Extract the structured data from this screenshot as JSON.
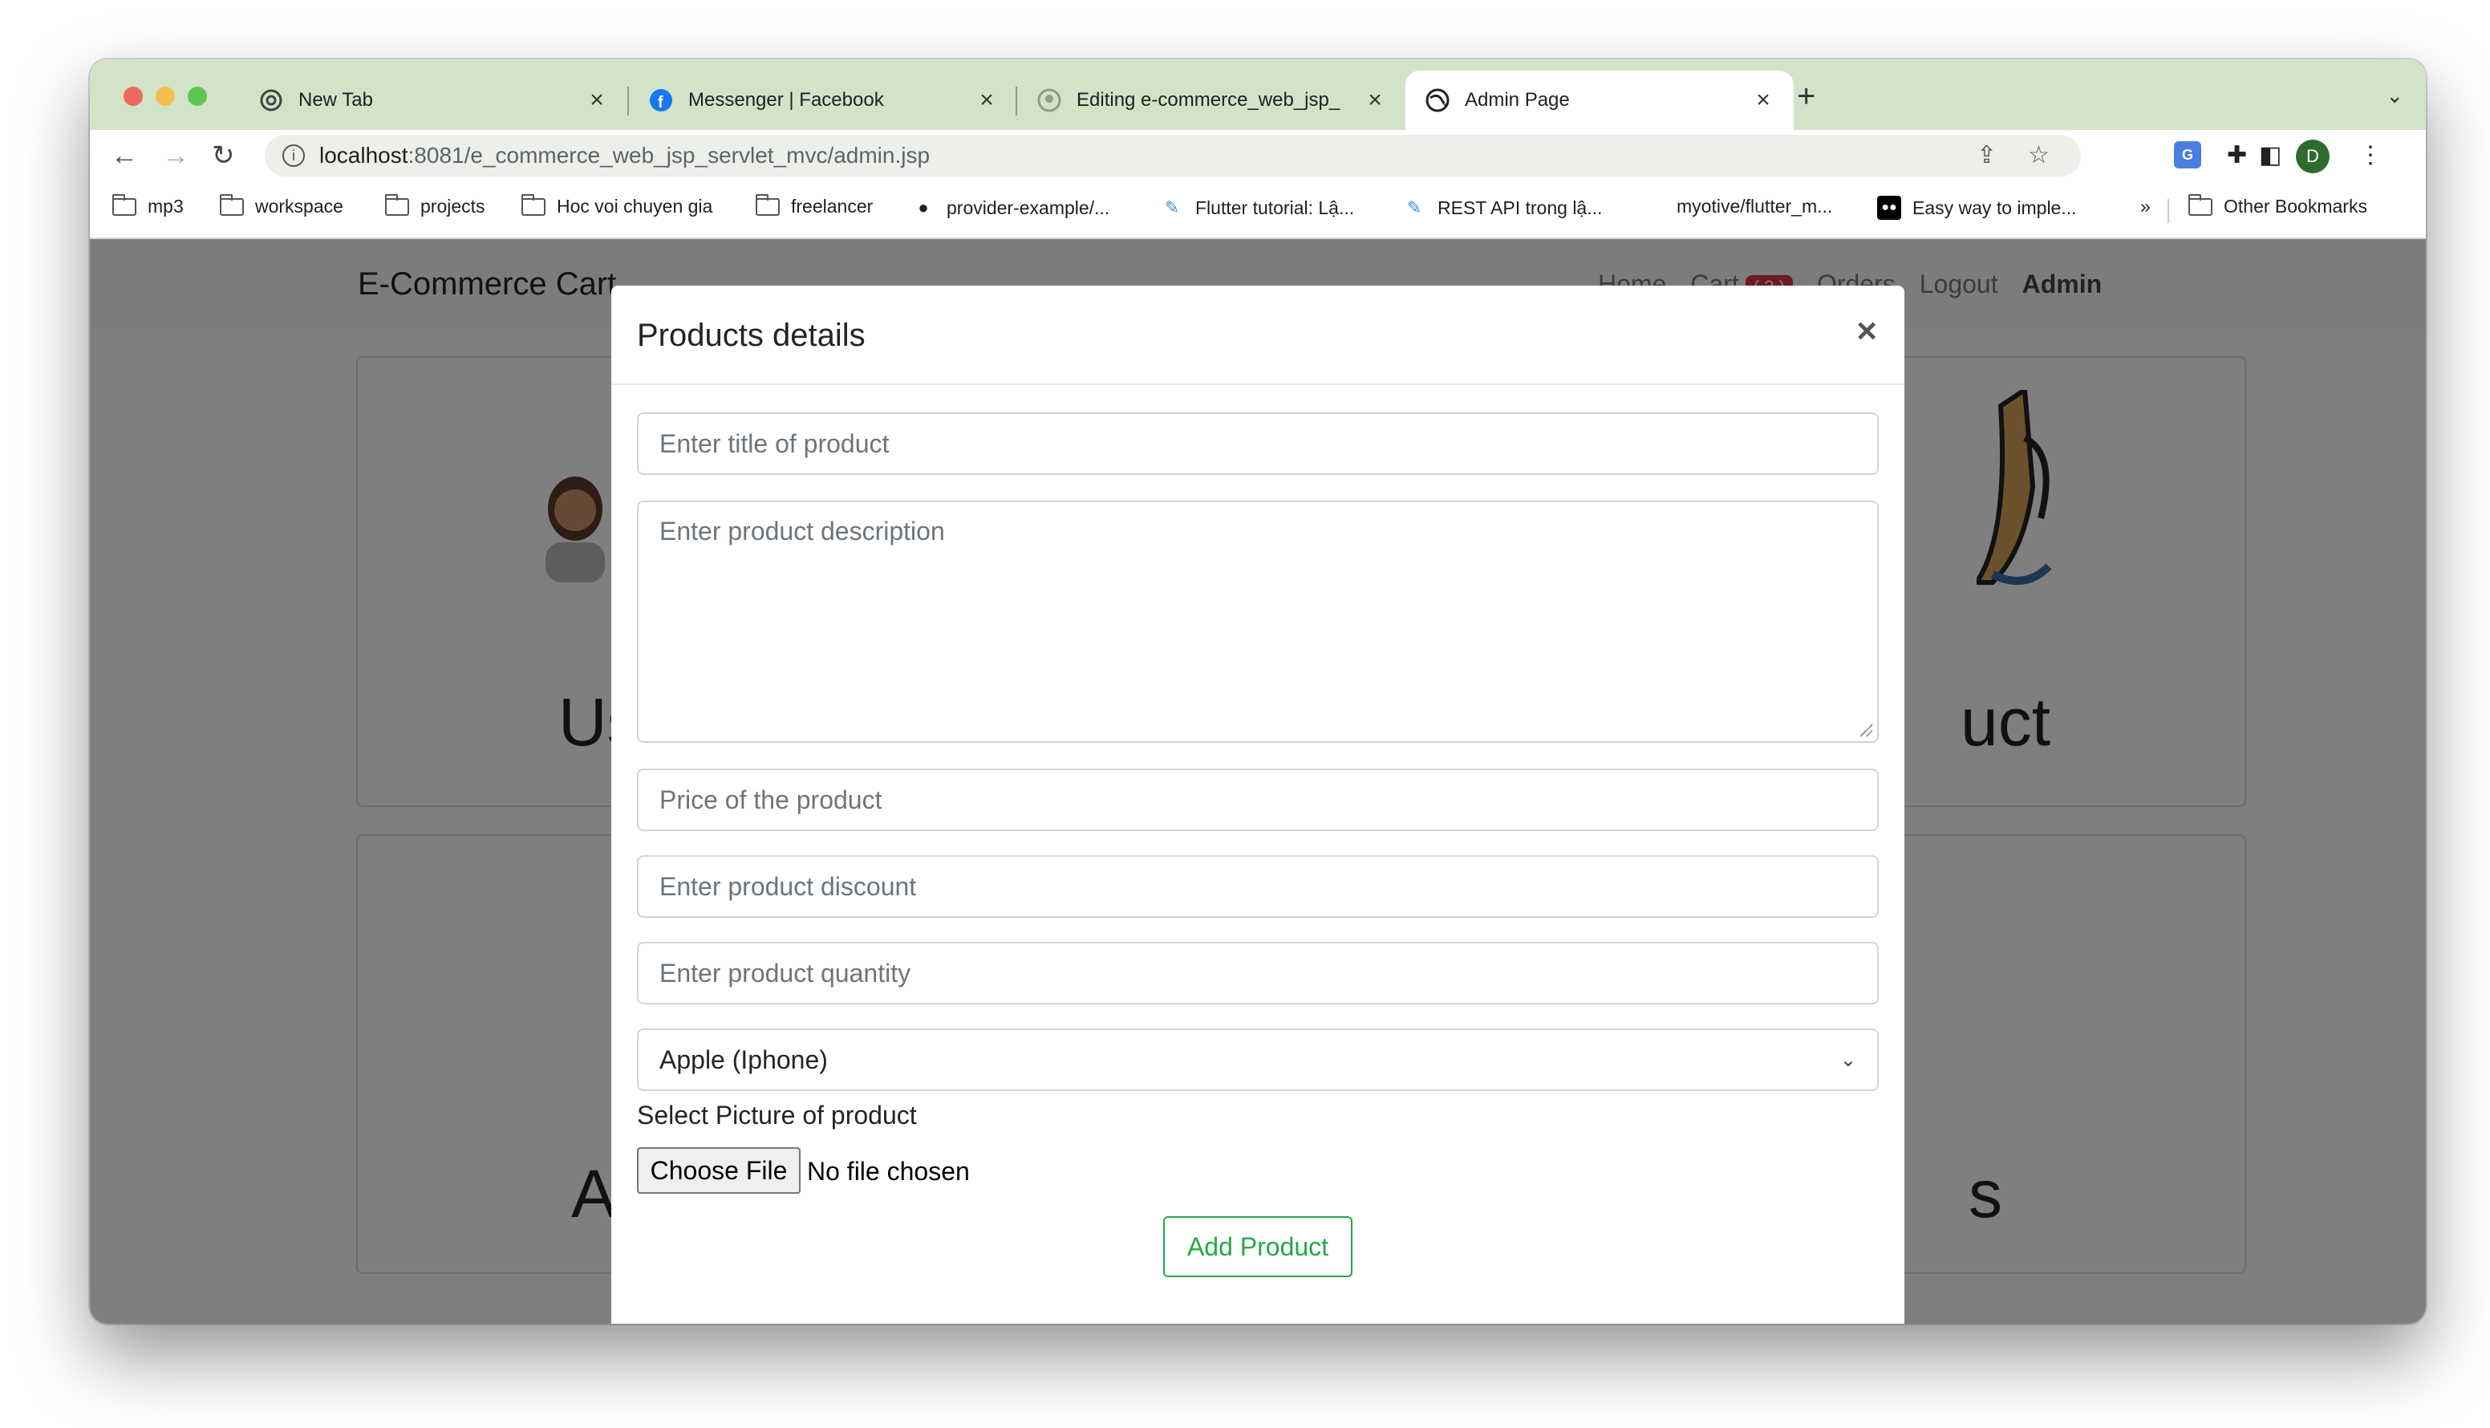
{
  "browser": {
    "tabs": [
      {
        "title": "New Tab",
        "icon": "chrome-icon"
      },
      {
        "title": "Messenger | Facebook",
        "icon": "facebook-icon"
      },
      {
        "title": "Editing e-commerce_web_jsp_",
        "icon": "github-icon"
      },
      {
        "title": "Admin Page",
        "icon": "globe-icon"
      }
    ],
    "url_host": "localhost",
    "url_rest": ":8081/e_commerce_web_jsp_servlet_mvc/admin.jsp",
    "profile_initial": "D",
    "bookmarks": [
      "mp3",
      "workspace",
      "projects",
      "Hoc voi chuyen gia",
      "freelancer",
      "provider-example/...",
      "Flutter tutorial: Lậ...",
      "REST API trong lậ...",
      "myotive/flutter_m...",
      "Easy way to imple...",
      "»",
      "Other Bookmarks"
    ]
  },
  "page": {
    "brand": "E-Commerce Cart",
    "nav": {
      "home": "Home",
      "cart": "Cart",
      "cart_count": "( 2 )",
      "orders": "Orders",
      "logout": "Logout",
      "admin": "Admin"
    },
    "card_fragments": [
      "Us",
      "uct",
      "A",
      "s"
    ]
  },
  "modal": {
    "title": "Products details",
    "close": "×",
    "title_placeholder": "Enter title of product",
    "description_placeholder": "Enter product description",
    "price_placeholder": "Price of the product",
    "discount_placeholder": "Enter product discount",
    "quantity_placeholder": "Enter product quantity",
    "category_selected": "Apple (Iphone)",
    "picture_label": "Select Picture of product",
    "choose_file": "Choose File",
    "no_file": "No file chosen",
    "submit": "Add Product"
  },
  "colors": {
    "tab_strip": "#d3e3c8",
    "accent_green": "#28a745",
    "badge_red": "#dc3545"
  }
}
